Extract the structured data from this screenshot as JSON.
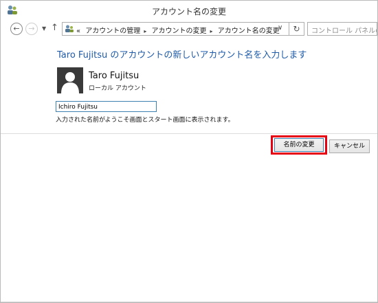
{
  "window": {
    "title": "アカウント名の変更",
    "app_icon": "users-icon"
  },
  "nav": {
    "back_icon": "back-arrow-icon",
    "forward_icon": "forward-arrow-icon",
    "history_icon": "chevron-down-icon",
    "up_icon": "up-arrow-icon",
    "back_glyph": "←",
    "forward_glyph": "→",
    "history_glyph": "▼",
    "up_glyph": "↑"
  },
  "address": {
    "overflow": "«",
    "crumbs": [
      "アカウントの管理",
      "アカウントの変更",
      "アカウント名の変更"
    ],
    "separator": "▸",
    "drop_glyph": "∨",
    "refresh_glyph": "↻"
  },
  "search": {
    "placeholder": "コントロール パネルの検索"
  },
  "main": {
    "heading": "Taro Fujitsu のアカウントの新しいアカウント名を入力します",
    "user_name": "Taro Fujitsu",
    "account_type": "ローカル アカウント",
    "new_name_value": "Ichiro Fujitsu",
    "hint": "入力された名前がようこそ画面とスタート画面に表示されます。"
  },
  "buttons": {
    "change_name": "名前の変更",
    "cancel": "キャンセル"
  },
  "colors": {
    "accent": "#1e5aa8",
    "highlight": "#e60012"
  }
}
